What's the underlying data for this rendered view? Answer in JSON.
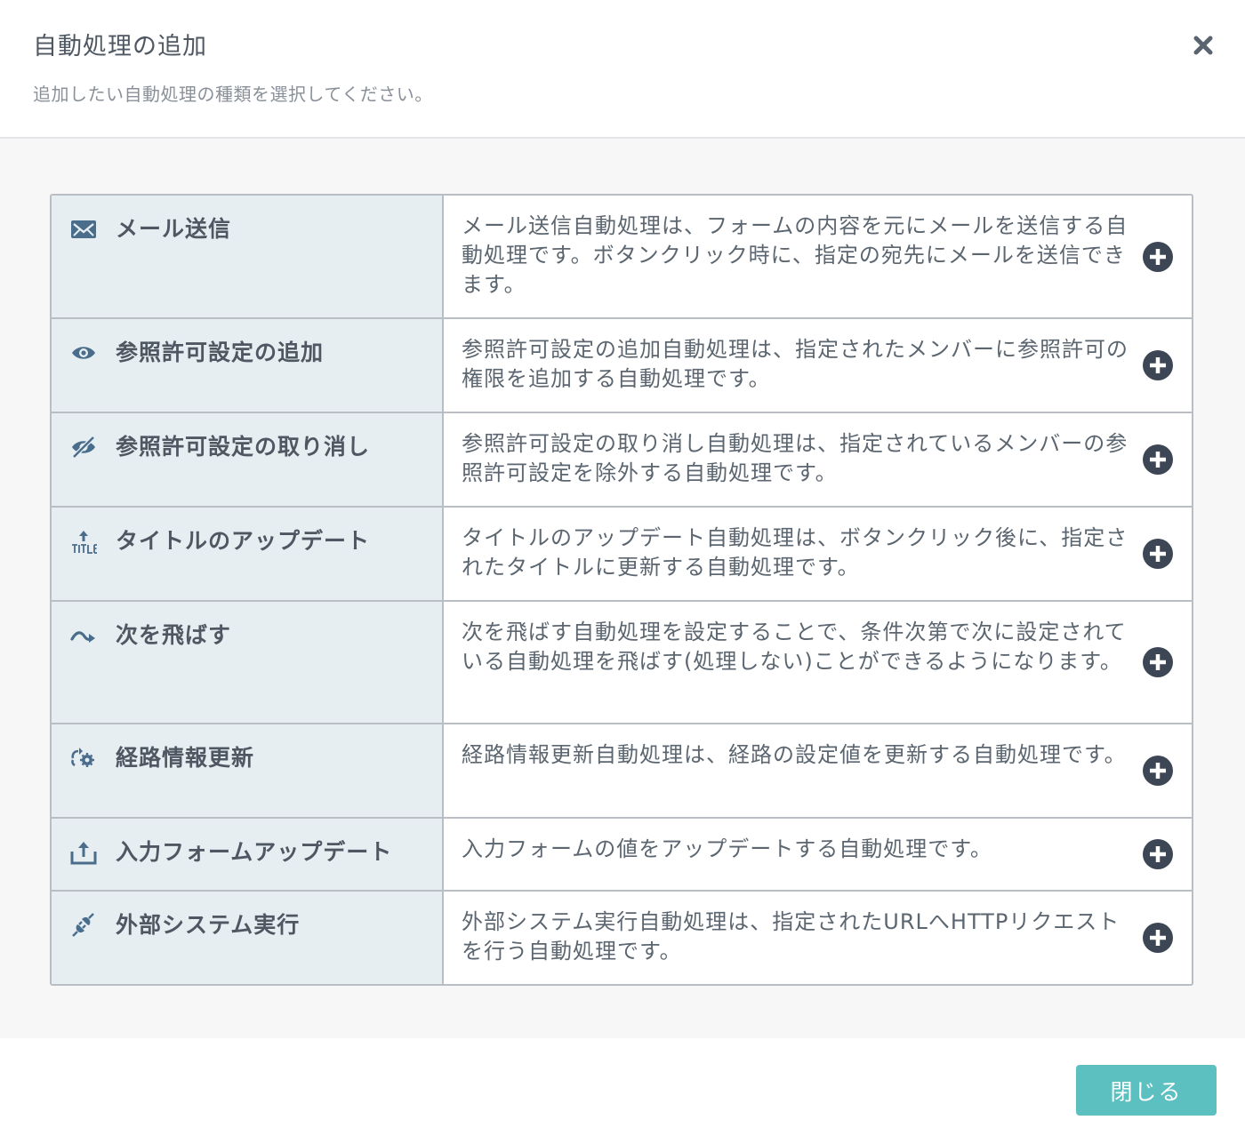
{
  "header": {
    "title": "自動処理の追加",
    "subtitle": "追加したい自動処理の種類を選択してください。",
    "close_icon": "close-icon"
  },
  "colors": {
    "name_cell_bg": "#e6eef2",
    "border": "#b8bec4",
    "icon": "#4a6d8c",
    "add_button": "#3d4654",
    "primary_button": "#5cc0c1"
  },
  "actions": [
    {
      "icon": "mail-icon",
      "name": "メール送信",
      "description": "メール送信自動処理は、フォームの内容を元にメールを送信する自動処理です。ボタンクリック時に、指定の宛先にメールを送信できます。"
    },
    {
      "icon": "eye-icon",
      "name": "参照許可設定の追加",
      "description": "参照許可設定の追加自動処理は、指定されたメンバーに参照許可の権限を追加する自動処理です。"
    },
    {
      "icon": "eye-slash-icon",
      "name": "参照許可設定の取り消し",
      "description": "参照許可設定の取り消し自動処理は、指定されているメンバーの参照許可設定を除外する自動処理です。"
    },
    {
      "icon": "title-update-icon",
      "name": "タイトルのアップデート",
      "description": "タイトルのアップデート自動処理は、ボタンクリック後に、指定されたタイトルに更新する自動処理です。"
    },
    {
      "icon": "skip-arrow-icon",
      "name": "次を飛ばす",
      "description": "次を飛ばす自動処理を設定することで、条件次第で次に設定されている自動処理を飛ばす(処理しない)ことができるようになります。"
    },
    {
      "icon": "route-settings-icon",
      "name": "経路情報更新",
      "description": "経路情報更新自動処理は、経路の設定値を更新する自動処理です。"
    },
    {
      "icon": "upload-icon",
      "name": "入力フォームアップデート",
      "description": "入力フォームの値をアップデートする自動処理です。"
    },
    {
      "icon": "plug-icon",
      "name": "外部システム実行",
      "description": "外部システム実行自動処理は、指定されたURLへHTTPリクエストを行う自動処理です。"
    }
  ],
  "footer": {
    "close_label": "閉じる"
  }
}
